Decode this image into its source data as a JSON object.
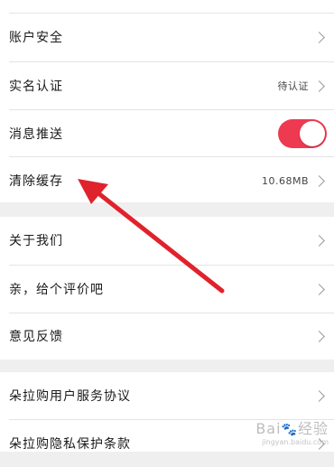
{
  "group1": {
    "items": [
      {
        "label": "账户安全"
      },
      {
        "label": "实名认证",
        "value": "待认证"
      },
      {
        "label": "消息推送",
        "toggle_on": true
      },
      {
        "label": "清除缓存",
        "value": "10.68MB"
      }
    ]
  },
  "group2": {
    "items": [
      {
        "label": "关于我们"
      },
      {
        "label": "亲，给个评价吧"
      },
      {
        "label": "意见反馈"
      }
    ]
  },
  "group3": {
    "items": [
      {
        "label": "朵拉购用户服务协议"
      },
      {
        "label": "朵拉购隐私保护条款"
      }
    ]
  },
  "watermark": {
    "text": "Bai",
    "text2": "经验",
    "sub": "jingyan.baidu.com"
  },
  "colors": {
    "toggle": "#ee3a50",
    "arrow": "#e0222c"
  }
}
